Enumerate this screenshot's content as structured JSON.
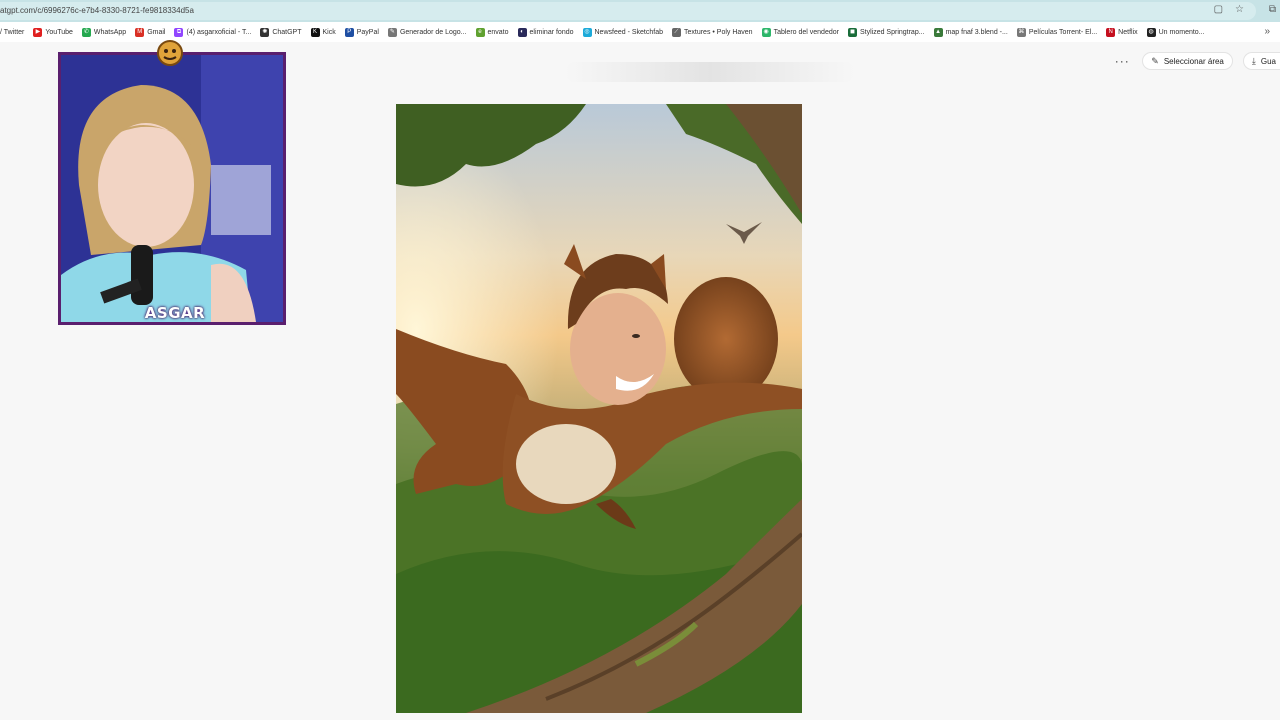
{
  "browser": {
    "url": "atgpt.com/c/6996276c-e7b4-8330-8721-fe9818334d5a",
    "icons": [
      "page-info-icon",
      "star-icon",
      "extensions-icon"
    ]
  },
  "bookmarks": [
    {
      "label": "/ Twitter",
      "icon": "",
      "color": ""
    },
    {
      "label": "YouTube",
      "icon": "▶",
      "color": "#e02020"
    },
    {
      "label": "WhatsApp",
      "icon": "✆",
      "color": "#25a84f"
    },
    {
      "label": "Gmail",
      "icon": "M",
      "color": "#d93025"
    },
    {
      "label": "(4) asgarxoficial - T...",
      "icon": "⧉",
      "color": "#9146ff"
    },
    {
      "label": "ChatGPT",
      "icon": "✺",
      "color": "#333333"
    },
    {
      "label": "Kick",
      "icon": "K",
      "color": "#111111"
    },
    {
      "label": "PayPal",
      "icon": "P",
      "color": "#1f4fa3"
    },
    {
      "label": "Generador de Logo...",
      "icon": "✎",
      "color": "#777777"
    },
    {
      "label": "envato",
      "icon": "e",
      "color": "#60a130"
    },
    {
      "label": "eliminar fondo",
      "icon": "◐",
      "color": "#2a2a5a"
    },
    {
      "label": "Newsfeed - Sketchfab",
      "icon": "◎",
      "color": "#1caad9"
    },
    {
      "label": "Textures • Poly Haven",
      "icon": "⟋",
      "color": "#666666"
    },
    {
      "label": "Tablero del vendedor",
      "icon": "◉",
      "color": "#2db66a"
    },
    {
      "label": "Stylized Springtrap...",
      "icon": "◼",
      "color": "#1a6d3a"
    },
    {
      "label": "map fnaf 3.blend -...",
      "icon": "▲",
      "color": "#3a7a3a"
    },
    {
      "label": "Películas Torrent- El...",
      "icon": "⌘",
      "color": "#777777"
    },
    {
      "label": "Netflix",
      "icon": "N",
      "color": "#c50f1f"
    },
    {
      "label": "Un momento...",
      "icon": "◍",
      "color": "#222222"
    }
  ],
  "toolbar": {
    "more_label": "···",
    "select_area_label": "Seleccionar área",
    "save_label": "Gua"
  },
  "webcam": {
    "name_overlay": "ASGAR"
  }
}
